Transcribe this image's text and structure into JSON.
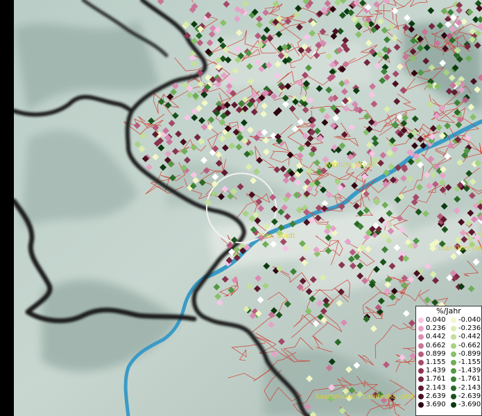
{
  "legend": {
    "title": "%/Jahr",
    "positive": [
      "0.040",
      "0.236",
      "0.442",
      "0.662",
      "0.899",
      "1.155",
      "1.439",
      "1.761",
      "2.143",
      "2.639",
      "3.690"
    ],
    "negative": [
      "-0.040",
      "-0.236",
      "-0.442",
      "-0.662",
      "-0.899",
      "-1.155",
      "-1.439",
      "-1.761",
      "-2.143",
      "-2.639",
      "-3.690"
    ],
    "positive_colors": [
      "#f7c6e6",
      "#e6a3c8",
      "#d98cb3",
      "#c97597",
      "#b75c7e",
      "#a44a68",
      "#8a3450",
      "#74273e",
      "#5e1b2d",
      "#4a1020",
      "#2e0610"
    ],
    "negative_colors": [
      "#f2f7c5",
      "#dcedae",
      "#c2e09a",
      "#a6d282",
      "#89c06a",
      "#6fae58",
      "#549846",
      "#3d8236",
      "#2a6a27",
      "#1a531a",
      "#0b3a10"
    ]
  },
  "cities": [
    {
      "id": "wittlich",
      "label": "Wittlich, Stadt"
    },
    {
      "id": "trier",
      "label": "Trier, Stadt"
    },
    {
      "id": "idar",
      "label": "Idar-Oberste"
    },
    {
      "id": "saarbruecken",
      "label": "Saarbrücken, Landeshauptst"
    }
  ],
  "colors": {
    "terrain_light": "#c4d4cc",
    "terrain_dark": "#8fa7a0",
    "river": "#3a9bc6",
    "district_border": "#d23a2e",
    "state_border": "#1a1a1a",
    "city_label": "#d6d23a"
  }
}
